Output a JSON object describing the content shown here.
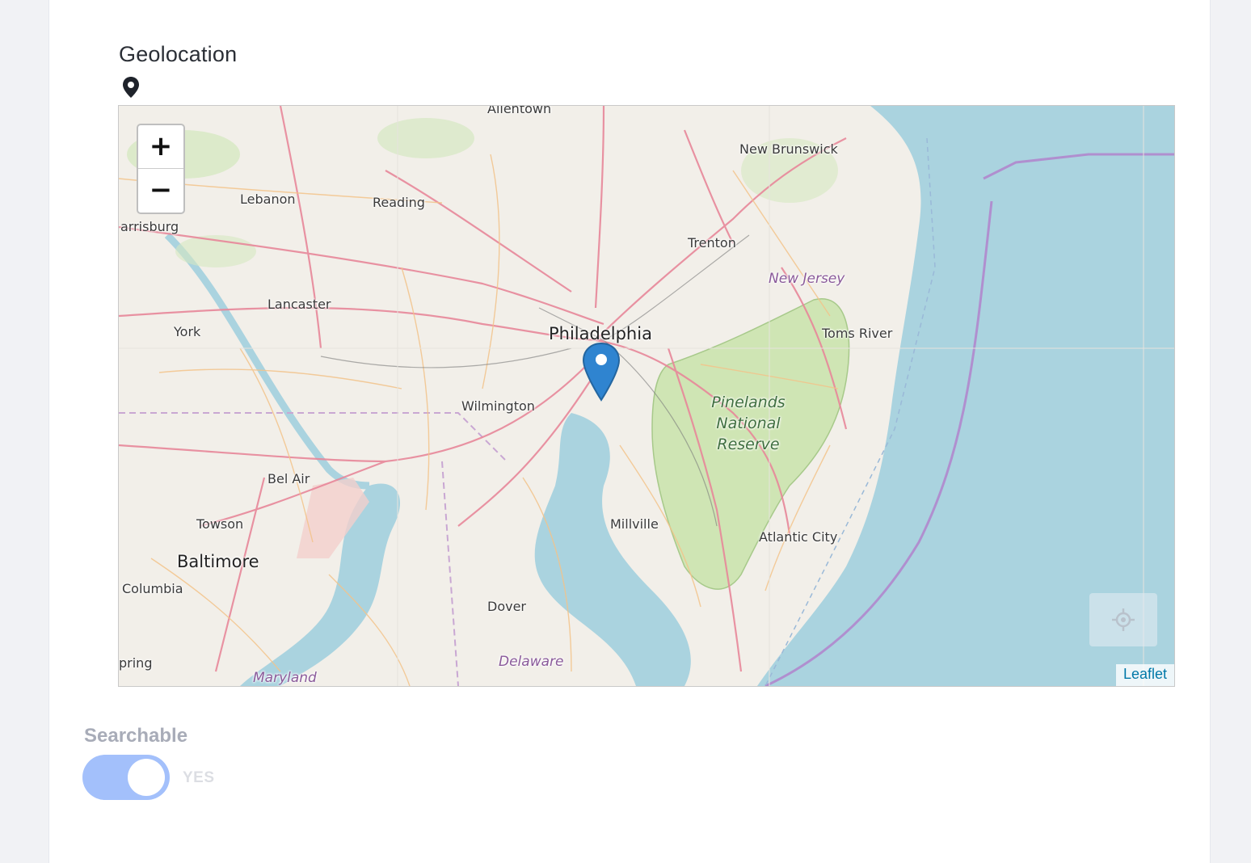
{
  "field": {
    "label": "Geolocation"
  },
  "map": {
    "zoom_in_label": "+",
    "zoom_out_label": "−",
    "attribution": "Leaflet",
    "places": {
      "allentown": "Allentown",
      "new_brunswick": "New Brunswick",
      "lebanon": "Lebanon",
      "reading": "Reading",
      "harrisburg": "arrisburg",
      "trenton": "Trenton",
      "new_jersey": "New Jersey",
      "lancaster": "Lancaster",
      "york": "York",
      "philadelphia": "Philadelphia",
      "toms_river": "Toms River",
      "wilmington": "Wilmington",
      "pinelands_1": "Pinelands",
      "pinelands_2": "National",
      "pinelands_3": "Reserve",
      "bel_air": "Bel Air",
      "towson": "Towson",
      "millville": "Millville",
      "atlantic_city": "Atlantic City",
      "baltimore": "Baltimore",
      "columbia": "Columbia",
      "dover": "Dover",
      "spring": "pring",
      "delaware": "Delaware",
      "maryland": "Maryland"
    },
    "colors": {
      "water": "#aad3df",
      "land": "#f2efe9",
      "park": "#cfe5b4",
      "road": "#e8879a",
      "minor_road": "#f3c38a"
    }
  },
  "searchable": {
    "label": "Searchable",
    "value_label": "YES",
    "enabled": true
  }
}
